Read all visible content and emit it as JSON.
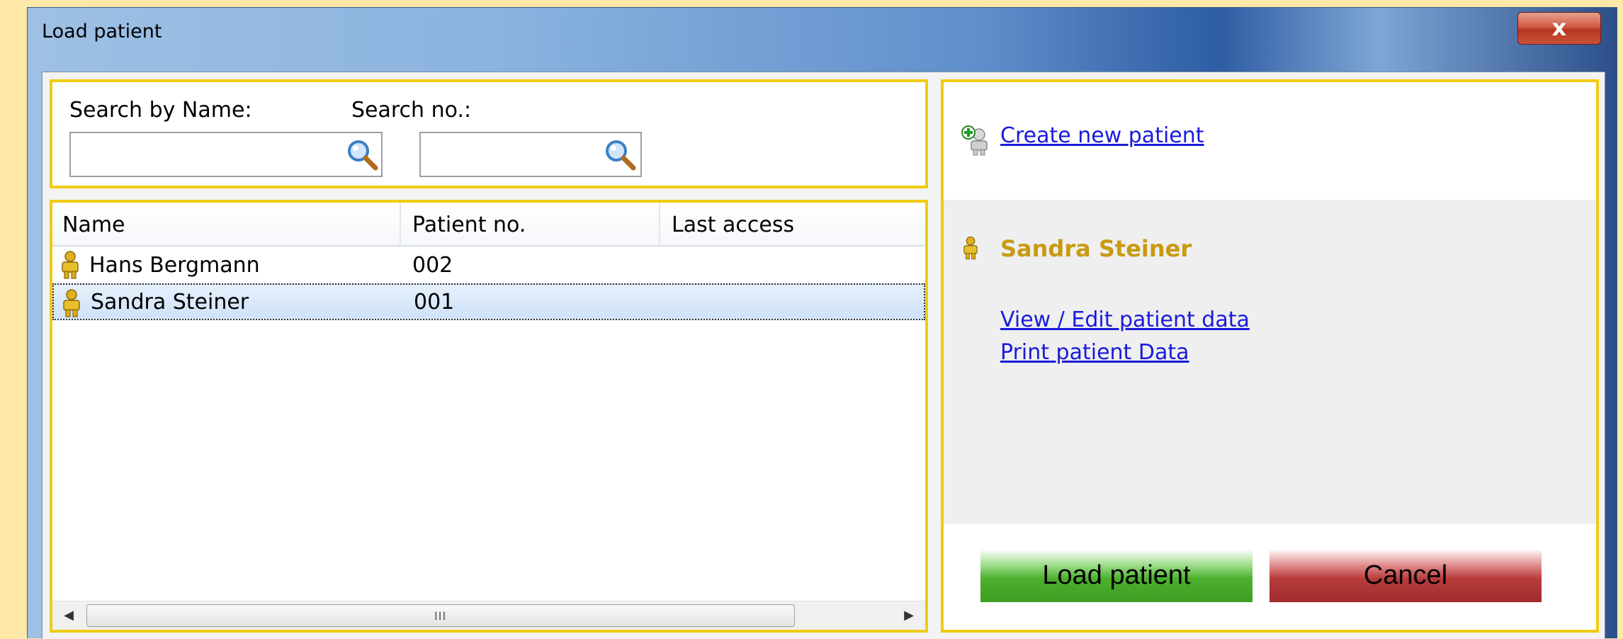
{
  "window": {
    "title": "Load patient",
    "close_label": "x"
  },
  "search": {
    "name_label": "Search by Name:",
    "number_label": "Search no.:",
    "name_value": "",
    "number_value": ""
  },
  "table": {
    "headers": [
      "Name",
      "Patient no.",
      "Last access"
    ],
    "rows": [
      {
        "name": "Hans Bergmann",
        "number": "002",
        "last_access": ""
      },
      {
        "name": "Sandra Steiner",
        "number": "001",
        "last_access": ""
      }
    ],
    "selected_row": 1,
    "scroll_grip": "III"
  },
  "side": {
    "create_link": "Create new patient",
    "selected_patient": "Sandra Steiner",
    "view_edit_link": "View / Edit patient data",
    "print_link": "Print patient Data"
  },
  "buttons": {
    "load": "Load patient",
    "cancel": "Cancel"
  },
  "colors": {
    "panel_border": "#efcb12",
    "accent_name": "#c99a10",
    "link": "#1a1adb"
  }
}
